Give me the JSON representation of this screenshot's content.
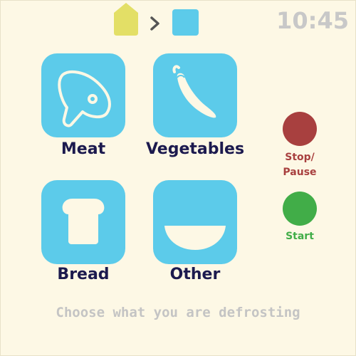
{
  "header": {
    "breadcrumb": [
      {
        "icon": "home-icon",
        "color": "#e3df66"
      },
      {
        "icon": "chevron-right-icon",
        "color": "#555555"
      },
      {
        "icon": "square-icon",
        "color": "#5ccbea"
      }
    ],
    "clock": "10:45"
  },
  "categories": [
    {
      "label": "Meat",
      "icon": "meat-icon"
    },
    {
      "label": "Vegetables",
      "icon": "chili-pepper-icon"
    },
    {
      "label": "Bread",
      "icon": "bread-icon"
    },
    {
      "label": "Other",
      "icon": "bowl-icon"
    }
  ],
  "controls": {
    "stop": {
      "line1": "Stop/",
      "line2": "Pause",
      "color": "#a8403f"
    },
    "start": {
      "label": "Start",
      "color": "#41ad48"
    }
  },
  "hint": "Choose what you are defrosting",
  "colors": {
    "background": "#fdf8e5",
    "tile": "#5ccbea",
    "label": "#1c1a4e",
    "muted": "#c4c4c4"
  }
}
